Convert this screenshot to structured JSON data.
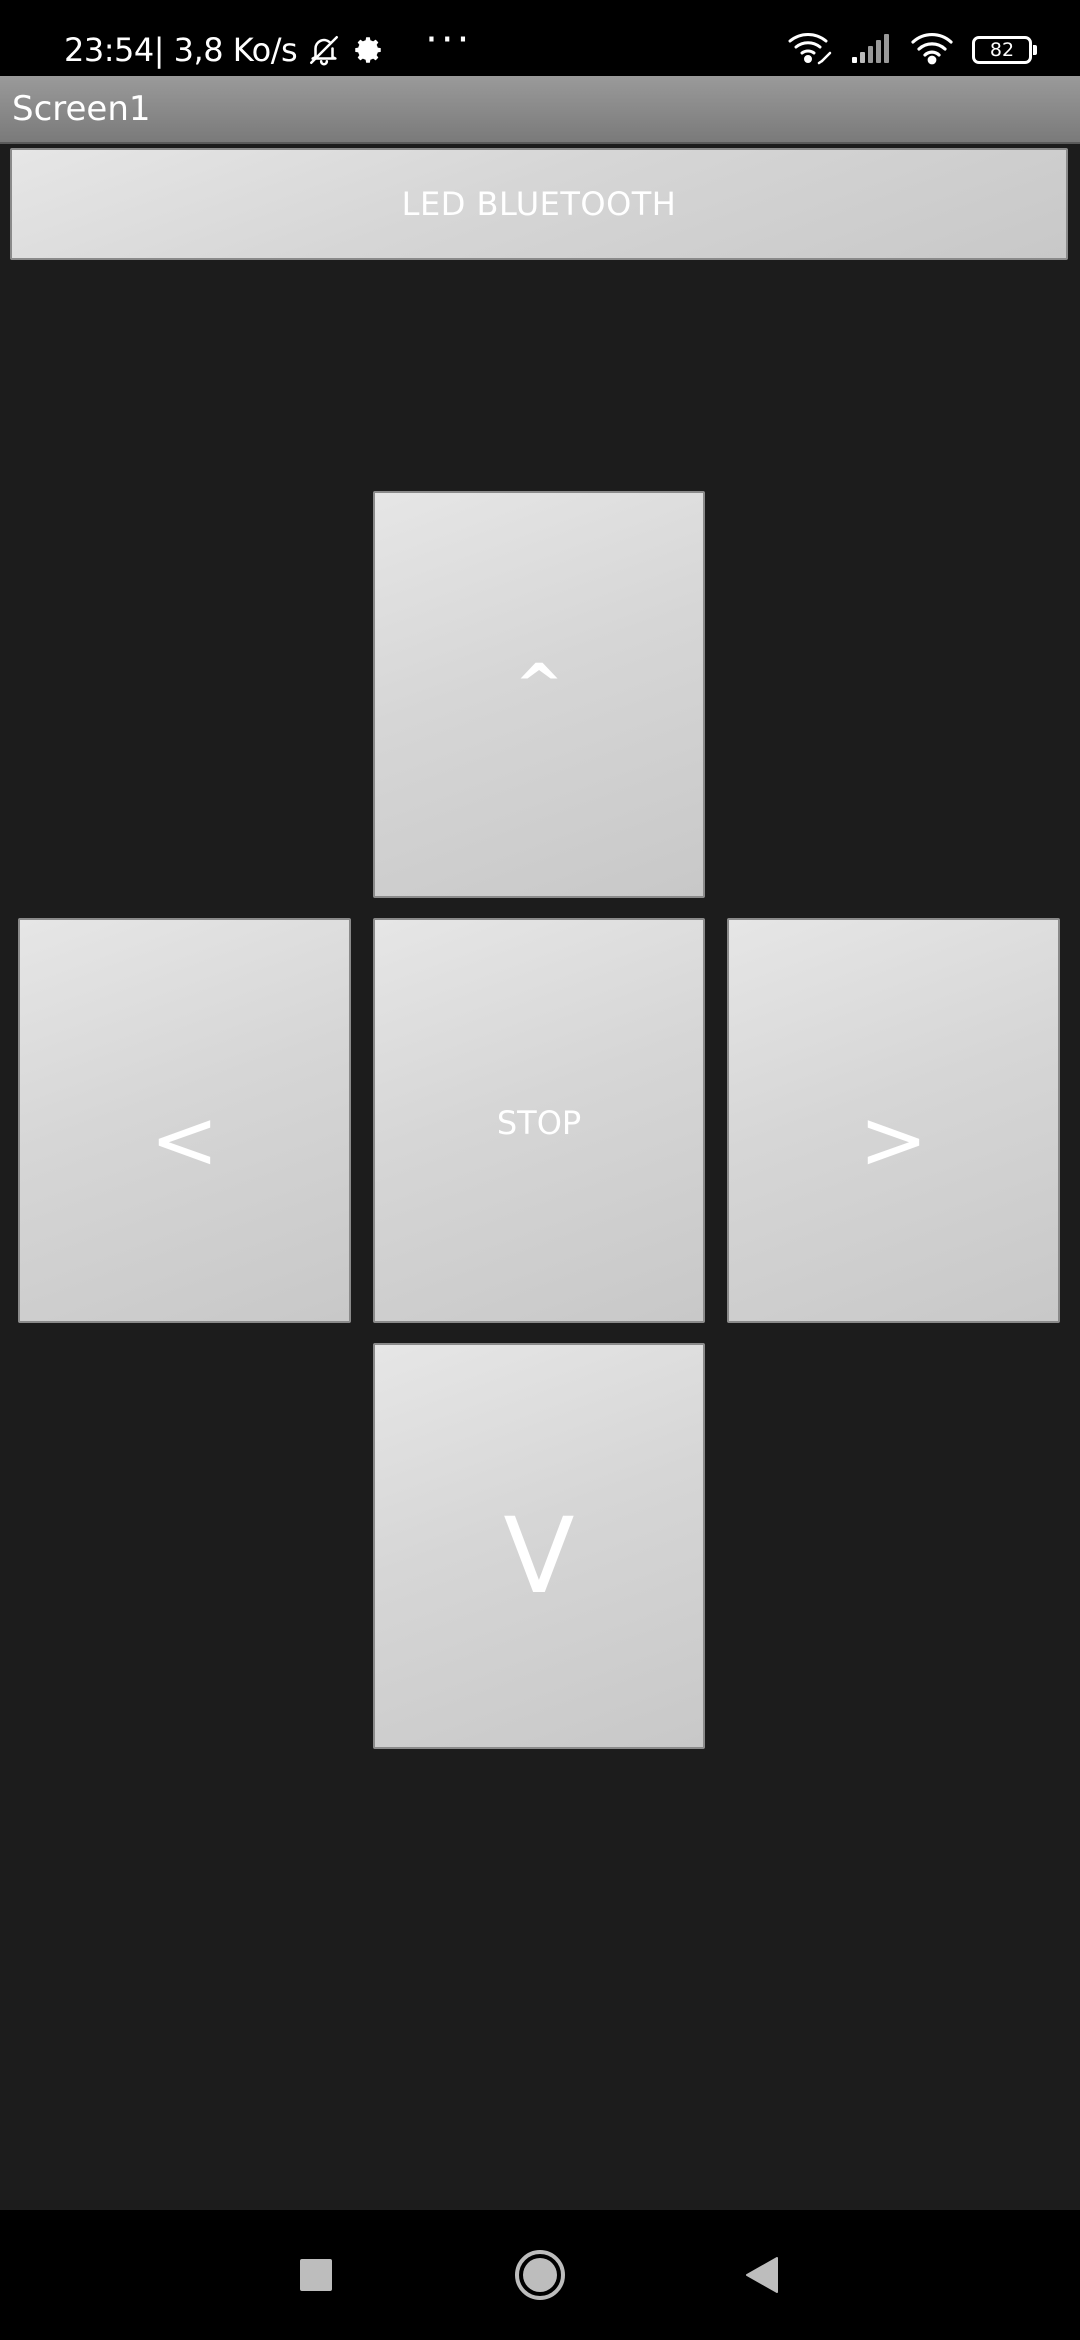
{
  "status_bar": {
    "time": "23:54",
    "speed": " | 3,8 Ko/s",
    "more": "···",
    "battery": "82",
    "icons": [
      "bell-off-icon",
      "gear-icon",
      "wifi-hotspot-icon",
      "signal-icon",
      "wifi-icon",
      "battery-icon"
    ]
  },
  "app": {
    "title": "Screen1"
  },
  "buttons": {
    "led": "LED BLUETOOTH",
    "up": "^",
    "left": "<",
    "stop": "STOP",
    "right": ">",
    "down": "V"
  },
  "nav_bar": {
    "icons": [
      "recent-apps-icon",
      "home-icon",
      "back-icon"
    ]
  },
  "colors": {
    "background": "#1c1c1c",
    "button_face": "#d6d6d6",
    "title_bar": "#8a8a8a",
    "text": "#ffffff"
  }
}
